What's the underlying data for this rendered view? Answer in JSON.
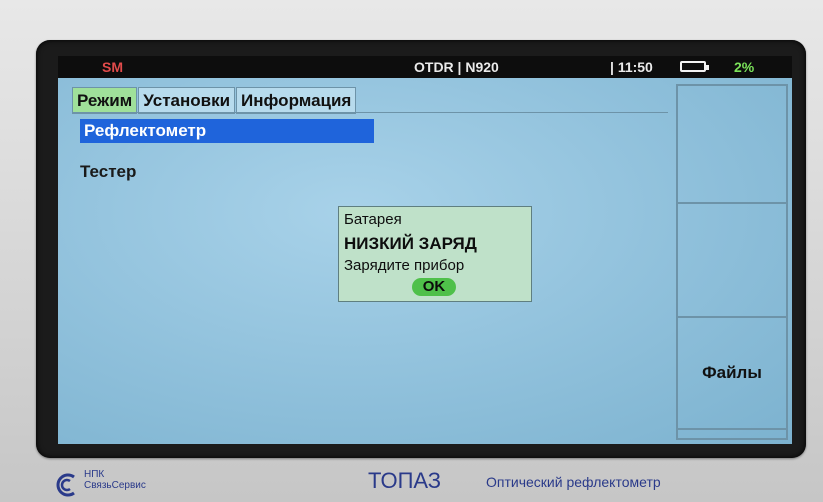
{
  "status_bar": {
    "left_label": "SM",
    "mode": "OTDR | N920",
    "separator": "|",
    "time": "11:50",
    "battery_percent": "2%",
    "battery_level": 0.02
  },
  "tabs": [
    {
      "label": "Режим",
      "active": true
    },
    {
      "label": "Установки",
      "active": false
    },
    {
      "label": "Информация",
      "active": false
    }
  ],
  "menu": {
    "items": [
      {
        "label": "Рефлектометр",
        "selected": true
      },
      {
        "label": "Тестер",
        "selected": false
      }
    ]
  },
  "softkeys": {
    "k1": "",
    "k2": "",
    "k3": "Файлы",
    "k4": ""
  },
  "dialog": {
    "title": "Батарея",
    "heading": "НИЗКИЙ ЗАРЯД",
    "message": "Зарядите прибор",
    "ok_label": "OK"
  },
  "device": {
    "company_line1": "НПК",
    "company_line2": "СвязьСервис",
    "product": "ТОПАЗ",
    "subtitle": "Оптический рефлектометр"
  },
  "colors": {
    "screen_bg": "#8fc0db",
    "active_tab": "#9fe09a",
    "selection": "#1f64db",
    "dialog_bg": "#bfe1c9",
    "ok_button": "#4fc04a",
    "battery_text": "#7be35a",
    "sm_text": "#e14b4b"
  }
}
